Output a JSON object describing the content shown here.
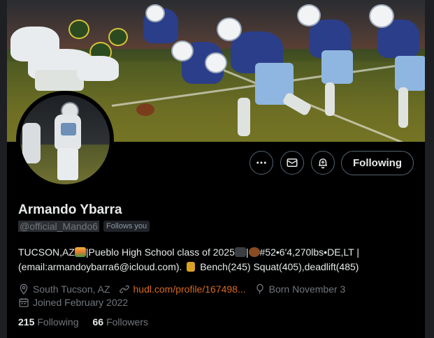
{
  "profile": {
    "name": "Armando Ybarra",
    "handle": "@official_Mando6",
    "follows_you": "Follows you",
    "bio_line1_a": "TUCSON,AZ",
    "bio_line1_b": "|Pueblo High School class of 2025",
    "bio_line1_c": "|",
    "bio_line1_d": "#52•6'4,270lbs•DE,LT |",
    "bio_line2_a": "(email:armandoybarra6@icloud.com).",
    "bio_line2_b": "Bench(245) Squat(405),deadlift(485)",
    "location": "South Tucson, AZ",
    "website": "hudl.com/profile/167498...",
    "birthday": "Born November 3",
    "joined": "Joined February 2022",
    "following_count": "215",
    "following_label": "Following",
    "followers_count": "66",
    "followers_label": "Followers"
  },
  "actions": {
    "follow_label": "Following",
    "more_icon": "more-horizontal-icon",
    "message_icon": "envelope-icon",
    "notify_icon": "bell-plus-icon"
  },
  "colors": {
    "background": "#000000",
    "link": "#d8691c",
    "muted": "#71767b"
  }
}
